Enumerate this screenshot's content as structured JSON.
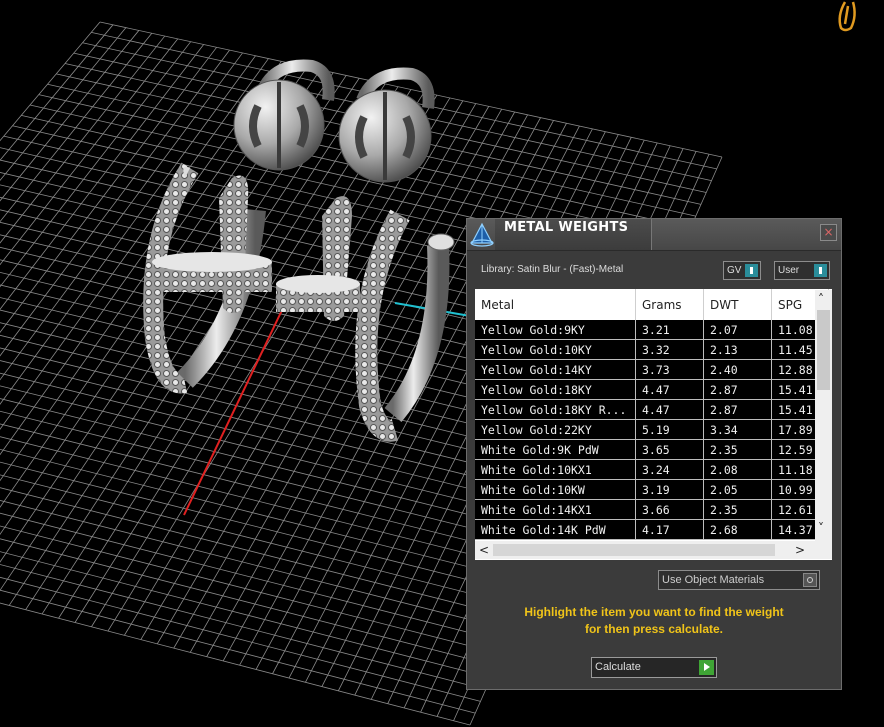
{
  "panel": {
    "title": "METAL WEIGHTS",
    "close_label": "×",
    "library_text": "Library: Satin Blur - (Fast)-Metal",
    "toggle_gv": "GV",
    "toggle_user": "User",
    "columns": [
      "Metal",
      "Grams",
      "DWT",
      "SPG"
    ],
    "rows": [
      [
        "Yellow Gold:9KY",
        "3.21",
        "2.07",
        "11.08"
      ],
      [
        "Yellow Gold:10KY",
        "3.32",
        "2.13",
        "11.45"
      ],
      [
        "Yellow Gold:14KY",
        "3.73",
        "2.40",
        "12.88"
      ],
      [
        "Yellow Gold:18KY",
        "4.47",
        "2.87",
        "15.41"
      ],
      [
        "Yellow Gold:18KY R...",
        "4.47",
        "2.87",
        "15.41"
      ],
      [
        "Yellow Gold:22KY",
        "5.19",
        "3.34",
        "17.89"
      ],
      [
        "White Gold:9K PdW",
        "3.65",
        "2.35",
        "12.59"
      ],
      [
        "White Gold:10KX1",
        "3.24",
        "2.08",
        "11.18"
      ],
      [
        "White Gold:10KW",
        "3.19",
        "2.05",
        "10.99"
      ],
      [
        "White Gold:14KX1",
        "3.66",
        "2.35",
        "12.61"
      ],
      [
        "White Gold:14K PdW",
        "4.17",
        "2.68",
        "14.37"
      ]
    ],
    "use_object_materials": "Use Object Materials",
    "instructions_line1": "Highlight the item you want to find the weight",
    "instructions_line2": "for then press calculate.",
    "calculate_label": "Calculate"
  },
  "colors": {
    "accent_toggle": "#2a8d9a",
    "instructions": "#f0c419",
    "go_button": "#3fa535",
    "x_axis": "#e02020",
    "y_axis": "#20c0d0"
  }
}
